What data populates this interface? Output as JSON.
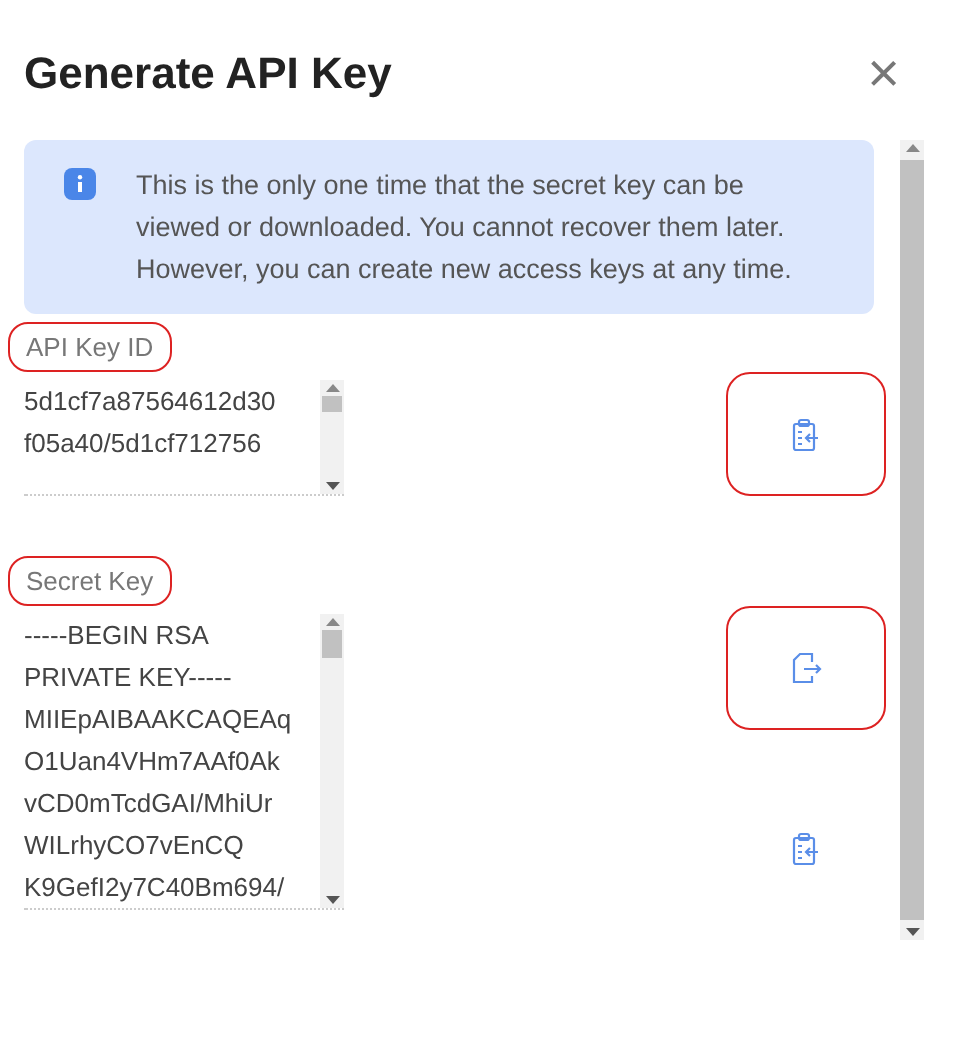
{
  "dialog": {
    "title": "Generate API Key",
    "close": "×"
  },
  "notice": {
    "text": "This is the only one time that the secret key can be viewed or downloaded. You cannot recover them later. However, you can create new access keys at any time."
  },
  "fields": [
    {
      "label": "API Key ID",
      "highlighted": true,
      "lines": [
        "5d1cf7a87564612d30",
        "f05a40/5d1cf712756"
      ],
      "actions": [
        {
          "kind": "copy",
          "highlighted": true
        }
      ]
    },
    {
      "label": "Secret Key",
      "highlighted": true,
      "lines": [
        "-----BEGIN RSA",
        "PRIVATE KEY-----",
        "MIIEpAIBAAKCAQEAq",
        "O1Uan4VHm7AAf0Ak",
        "vCD0mTcdGAI/MhiUr",
        "WILrhyCO7vEnCQ",
        "K9GefI2y7C40Bm694/"
      ],
      "actions": [
        {
          "kind": "download",
          "highlighted": true
        },
        {
          "kind": "copy",
          "highlighted": false
        }
      ]
    }
  ]
}
